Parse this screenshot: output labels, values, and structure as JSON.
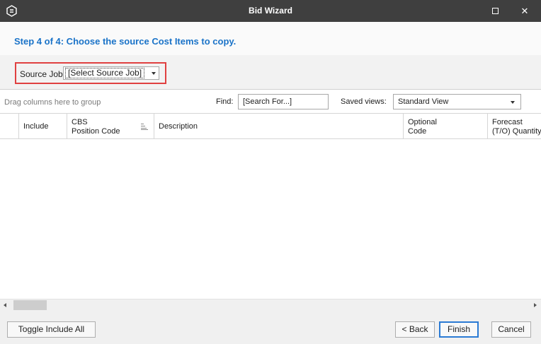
{
  "window": {
    "title": "Bid Wizard"
  },
  "step": {
    "title": "Step 4 of 4: Choose the source Cost Items to copy."
  },
  "source_job": {
    "label": "Source Job:",
    "value": "[Select Source Job]"
  },
  "grid": {
    "group_hint": "Drag columns here to group",
    "find_label": "Find:",
    "find_placeholder": "[Search For...]",
    "saved_views_label": "Saved views:",
    "saved_view_value": "Standard View",
    "columns": {
      "include": "Include",
      "cbs_line1": "CBS",
      "cbs_line2": "Position Code",
      "description": "Description",
      "optional_line1": "Optional",
      "optional_line2": "Code",
      "forecast_line1": "Forecast",
      "forecast_line2": "(T/O) Quantity"
    },
    "rows": []
  },
  "footer": {
    "toggle_include_all": "Toggle Include All",
    "back": "< Back",
    "finish": "Finish",
    "cancel": "Cancel"
  },
  "colors": {
    "titlebar": "#3f3f3f",
    "step_title": "#1a73c8",
    "highlight": "#e04040",
    "finish_border": "#2a7ad4"
  }
}
